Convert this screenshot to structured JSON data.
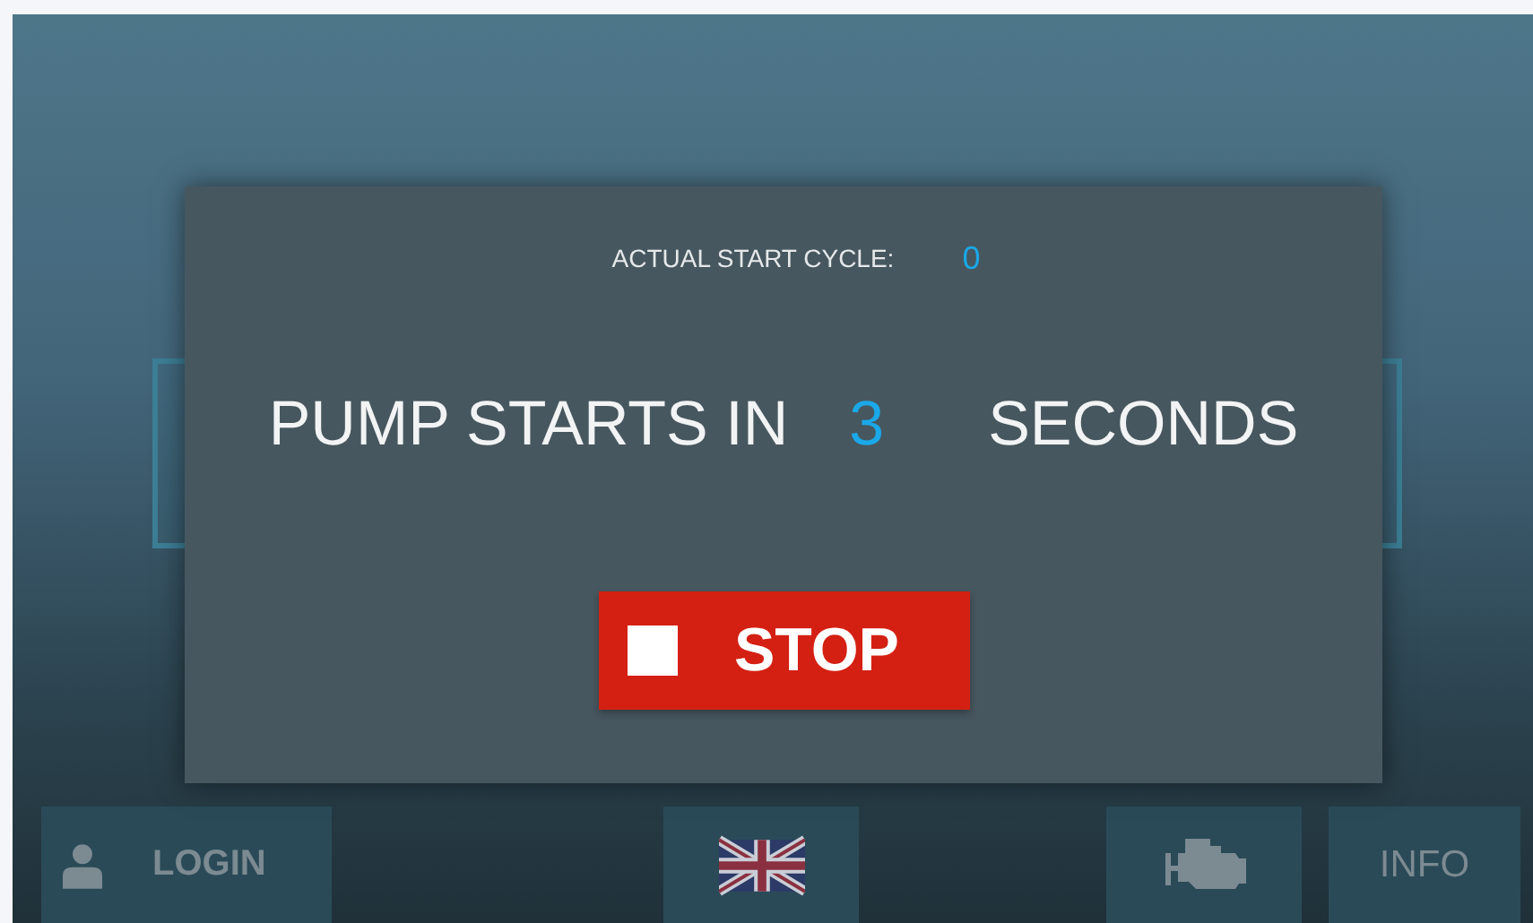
{
  "dialog": {
    "cycle_label": "ACTUAL START CYCLE:",
    "cycle_value": "0",
    "message_prefix": "PUMP STARTS IN",
    "countdown": "3",
    "message_suffix": "SECONDS",
    "stop_button": "STOP"
  },
  "bottom_bar": {
    "login": "LOGIN",
    "info": "INFO"
  }
}
